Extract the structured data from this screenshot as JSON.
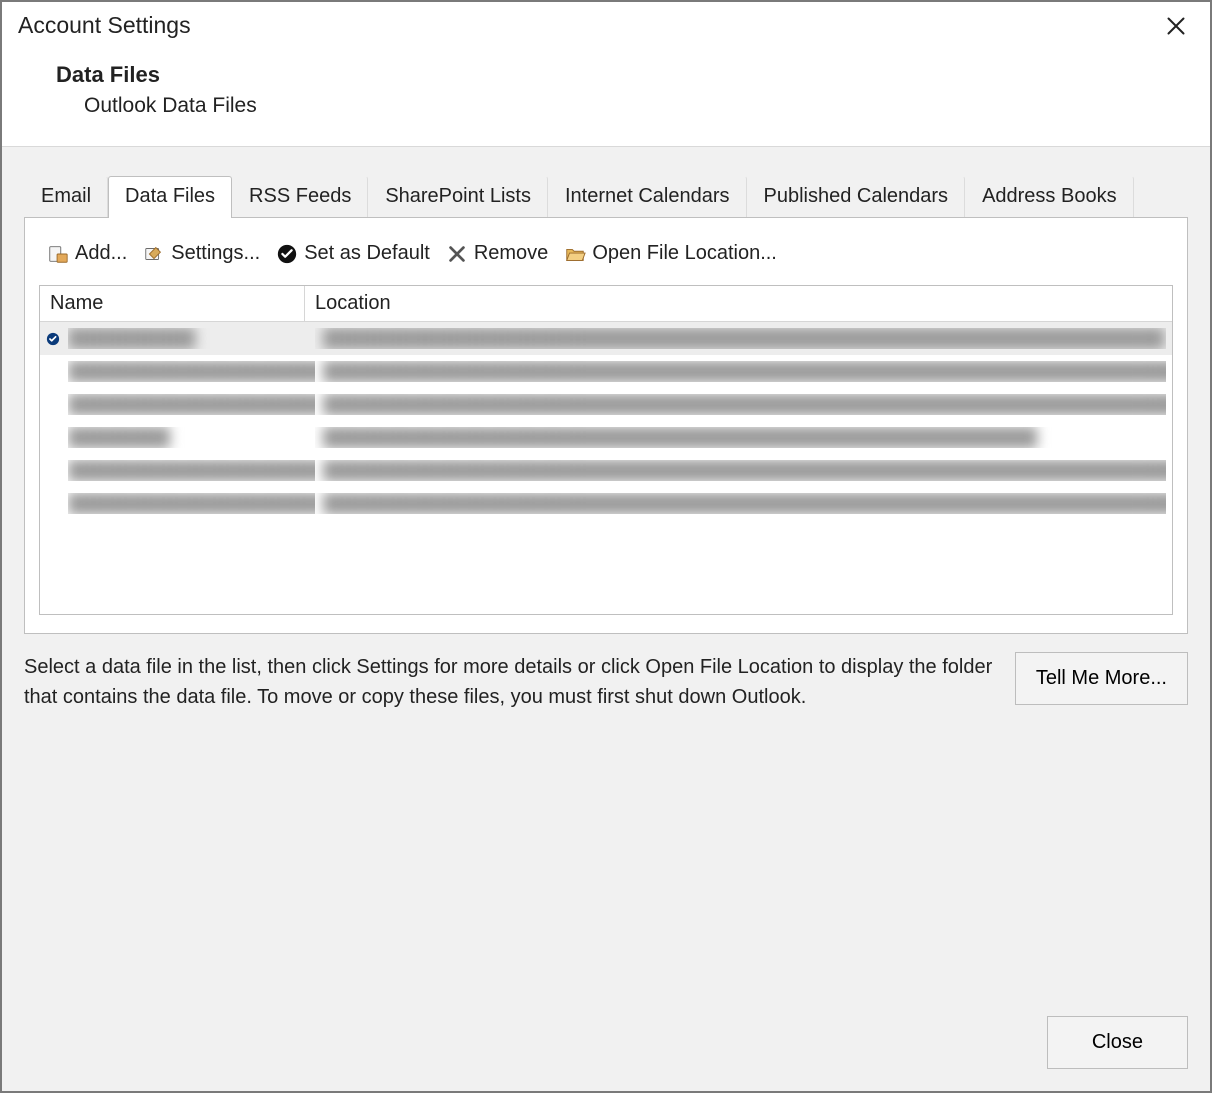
{
  "window": {
    "title": "Account Settings"
  },
  "header": {
    "heading": "Data Files",
    "subheading": "Outlook Data Files"
  },
  "tabs": [
    {
      "label": "Email"
    },
    {
      "label": "Data Files"
    },
    {
      "label": "RSS Feeds"
    },
    {
      "label": "SharePoint Lists"
    },
    {
      "label": "Internet Calendars"
    },
    {
      "label": "Published Calendars"
    },
    {
      "label": "Address Books"
    }
  ],
  "active_tab_index": 1,
  "toolbar": {
    "add": "Add...",
    "settings": "Settings...",
    "set_default": "Set as Default",
    "remove": "Remove",
    "open_location": "Open File Location..."
  },
  "grid": {
    "columns": {
      "name": "Name",
      "location": "Location"
    },
    "rows": [
      {
        "default": true,
        "name": "██████████",
        "location": "██████████████████████████████████████████████████████████████████"
      },
      {
        "default": false,
        "name": "████████████████████████",
        "location": "█████████████████████████████████████████████████████████████████████████"
      },
      {
        "default": false,
        "name": "█████████████████████████",
        "location": "████████████████████████████████████████████████████████████████████████████████"
      },
      {
        "default": false,
        "name": "████████",
        "location": "████████████████████████████████████████████████████████"
      },
      {
        "default": false,
        "name": "██████████████████████████",
        "location": "████████████████████████████████████████████████████████████████████████████████████"
      },
      {
        "default": false,
        "name": "█████████████████████████████",
        "location": "██████████████████████████████████████████████████████████████████████████████████"
      }
    ]
  },
  "info": {
    "text": "Select a data file in the list, then click Settings for more details or click Open File Location to display the folder that contains the data file. To move or copy these files, you must first shut down Outlook.",
    "tell_me_more": "Tell Me More..."
  },
  "footer": {
    "close": "Close"
  }
}
